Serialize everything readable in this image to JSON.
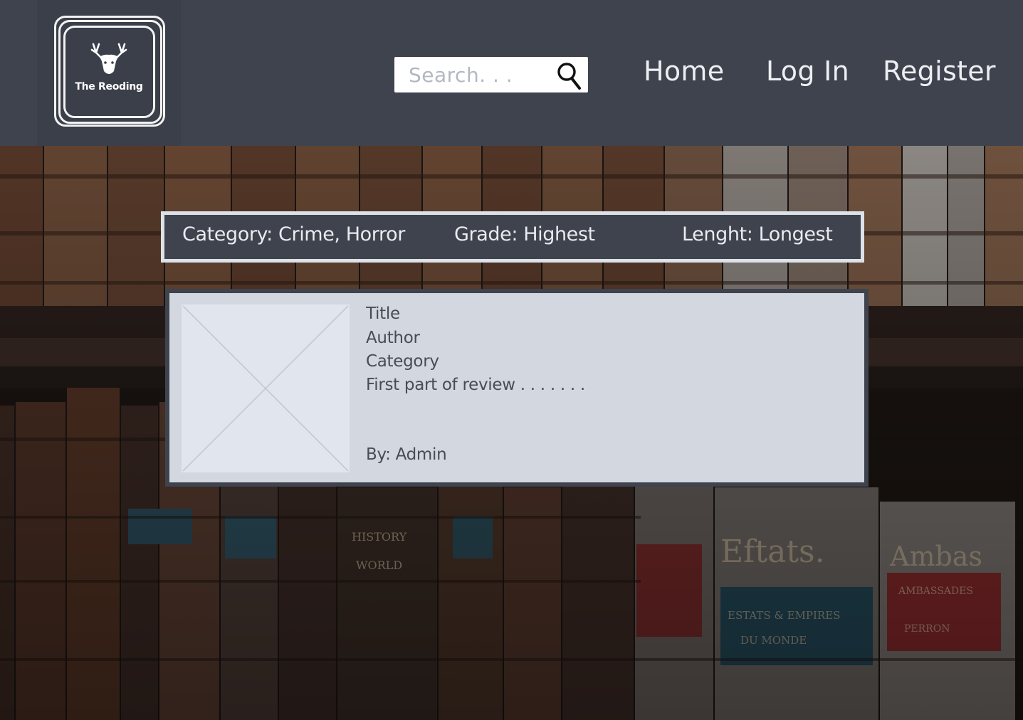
{
  "logo": {
    "text": "The Reoding",
    "icon": "deer-head-icon"
  },
  "search": {
    "placeholder": "Search. . .",
    "icon": "search-icon"
  },
  "nav": {
    "home": "Home",
    "login": "Log In",
    "register": "Register"
  },
  "filters": {
    "category": "Category: Crime, Horror",
    "grade": "Grade: Highest",
    "length": "Lenght: Longest"
  },
  "review_card": {
    "title": "Title",
    "author": "Author",
    "category": "Category",
    "review_excerpt": "First part of review . . . . . . .",
    "by": "By: Admin",
    "image": "image-placeholder-icon"
  },
  "colors": {
    "header_bg": "#3e434d",
    "card_bg": "#d3d7df",
    "filter_bar_border": "#dde1e8",
    "text_light": "#eceef2"
  }
}
